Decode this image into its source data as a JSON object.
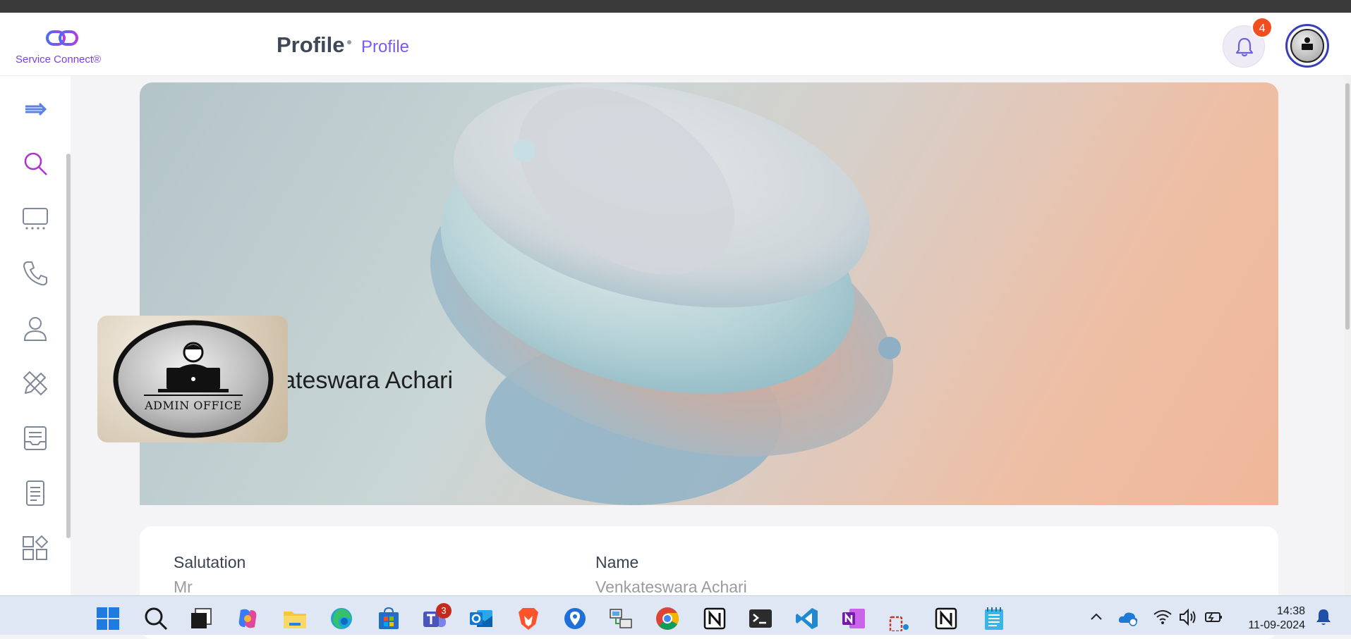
{
  "app": {
    "brand": "Service Connect®",
    "page_title": "Profile",
    "breadcrumb": "Profile",
    "notification_count": "4"
  },
  "sidebar": {
    "items": [
      "collapse-toggle",
      "search",
      "dashboard",
      "calls",
      "contacts",
      "edit-tools",
      "tasks",
      "documents",
      "apps"
    ]
  },
  "profile": {
    "name": "Venkateswara Achari",
    "cover_name_visible": "ateswara Achari",
    "picture_caption": "ADMIN OFFICE",
    "fields": [
      {
        "label": "Salutation",
        "value": "Mr"
      },
      {
        "label": "Name",
        "value": "Venkateswara Achari"
      }
    ]
  },
  "taskbar": {
    "apps": [
      "start",
      "search",
      "task-view",
      "copilot",
      "file-explorer",
      "edge",
      "store",
      "teams",
      "outlook",
      "brave",
      "maps",
      "remote-desktop",
      "chrome",
      "notion",
      "terminal",
      "vscode",
      "onenote",
      "snipping-tool",
      "notion-2",
      "notepad"
    ],
    "teams_badge": "3",
    "time": "14:38",
    "date": "11-09-2024"
  },
  "colors": {
    "accent": "#7a5af0",
    "brand_purple": "#7b3fe4",
    "badge": "#f04e1e"
  }
}
